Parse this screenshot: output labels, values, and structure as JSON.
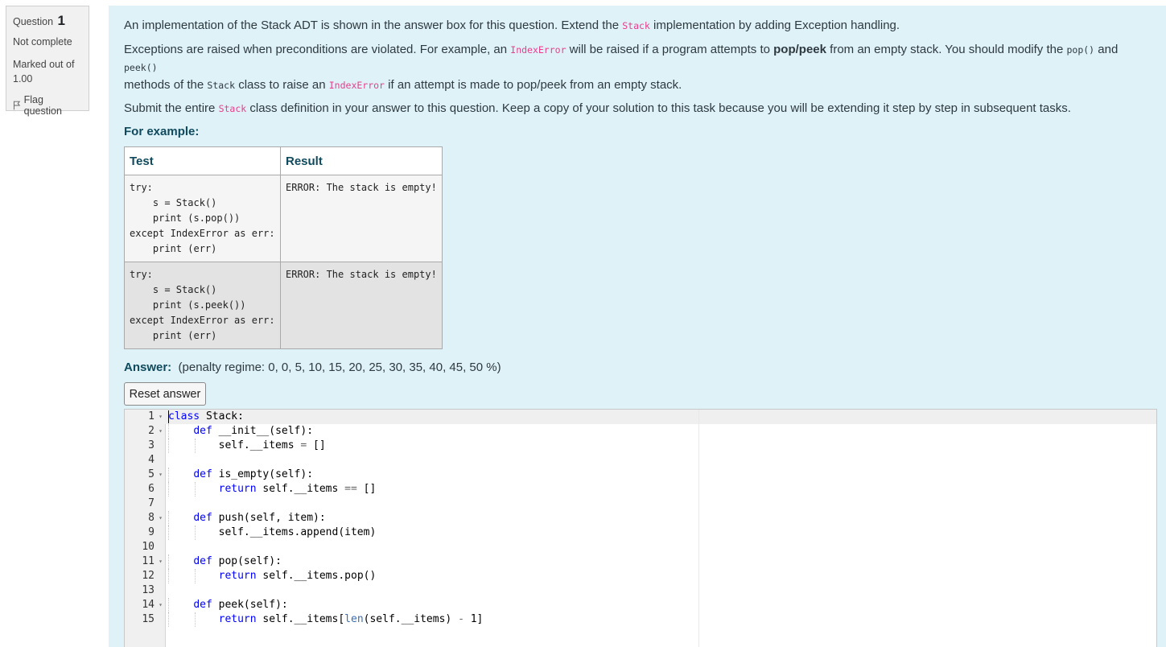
{
  "info": {
    "question_prefix": "Question",
    "question_number": "1",
    "state": "Not complete",
    "marks": "Marked out of 1.00",
    "flag_label": "Flag question"
  },
  "question": {
    "p1_before": "An implementation of the Stack ADT is shown in the answer box for this question. Extend the ",
    "p1_code": "Stack",
    "p1_after": " implementation by adding Exception handling.",
    "p2_a": "Exceptions are raised when preconditions are violated. For example, an ",
    "p2_code1": "IndexError",
    "p2_b": " will be raised if a program attempts to ",
    "p2_bold": "pop/peek",
    "p2_c": " from an empty stack. You should modify the ",
    "p2_code2": "pop()",
    "p2_d": " and ",
    "p2_code3": "peek()",
    "p2_e": " methods of the ",
    "p2_code4": "Stack",
    "p2_f": " class to raise an ",
    "p2_code5": "IndexError",
    "p2_g": " if an attempt is made to pop/peek from an empty stack.",
    "p3_a": "Submit the entire ",
    "p3_code": "Stack",
    "p3_b": " class definition in your answer to this question. Keep a copy of your solution to this task because you will be extending it step by step in subsequent tasks.",
    "for_example": "For example:"
  },
  "examples": {
    "headers": [
      "Test",
      "Result"
    ],
    "rows": [
      {
        "test": "try:\n    s = Stack()\n    print (s.pop())\nexcept IndexError as err:\n    print (err)",
        "result": "ERROR: The stack is empty!"
      },
      {
        "test": "try:\n    s = Stack()\n    print (s.peek())\nexcept IndexError as err:\n    print (err)",
        "result": "ERROR: The stack is empty!"
      }
    ]
  },
  "answer": {
    "label": "Answer:",
    "penalty": "(penalty regime: 0, 0, 5, 10, 15, 20, 25, 30, 35, 40, 45, 50 %)",
    "reset_label": "Reset answer"
  },
  "editor": {
    "keyword_color": "#0000ff",
    "operator_color": "#666666",
    "lines": [
      {
        "num": "1",
        "fold": true,
        "code": "class Stack:"
      },
      {
        "num": "2",
        "fold": true,
        "code": "    def __init__(self):"
      },
      {
        "num": "3",
        "fold": false,
        "code": "        self.__items = []"
      },
      {
        "num": "4",
        "fold": false,
        "code": ""
      },
      {
        "num": "5",
        "fold": true,
        "code": "    def is_empty(self):"
      },
      {
        "num": "6",
        "fold": false,
        "code": "        return self.__items == []"
      },
      {
        "num": "7",
        "fold": false,
        "code": ""
      },
      {
        "num": "8",
        "fold": true,
        "code": "    def push(self, item):"
      },
      {
        "num": "9",
        "fold": false,
        "code": "        self.__items.append(item)"
      },
      {
        "num": "10",
        "fold": false,
        "code": ""
      },
      {
        "num": "11",
        "fold": true,
        "code": "    def pop(self):"
      },
      {
        "num": "12",
        "fold": false,
        "code": "        return self.__items.pop()"
      },
      {
        "num": "13",
        "fold": false,
        "code": ""
      },
      {
        "num": "14",
        "fold": true,
        "code": "    def peek(self):"
      },
      {
        "num": "15",
        "fold": false,
        "code": "        return self.__items[len(self.__items) - 1]"
      }
    ]
  }
}
